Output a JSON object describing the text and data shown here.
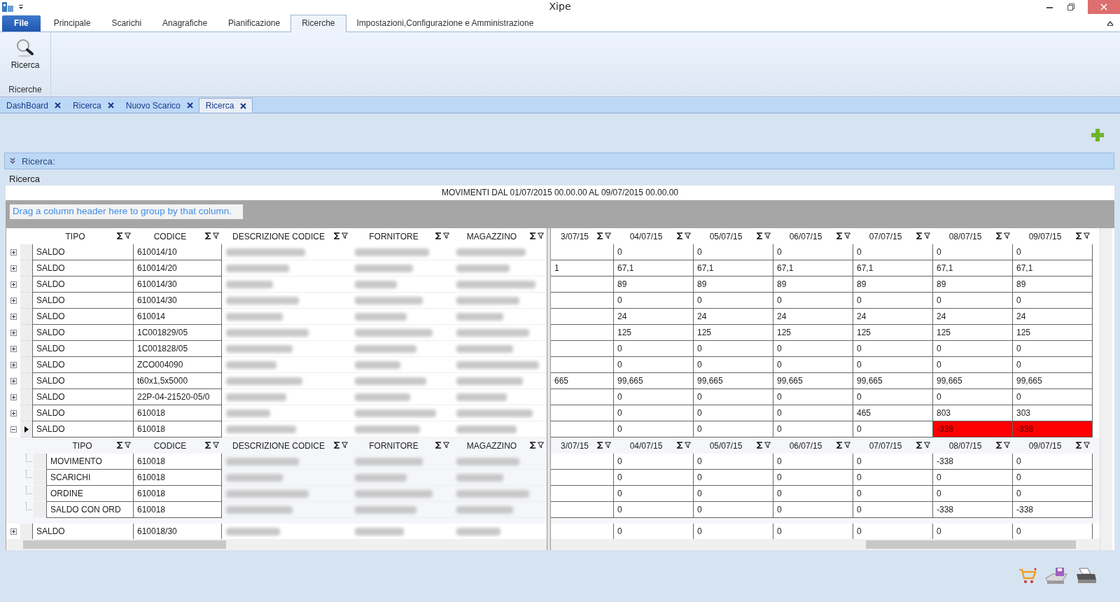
{
  "window": {
    "title": "Xipe"
  },
  "ribbon_tabs": [
    {
      "label": "File",
      "kind": "file",
      "selected": false
    },
    {
      "label": "Principale",
      "kind": "tab",
      "selected": false
    },
    {
      "label": "Scarichi",
      "kind": "tab",
      "selected": false
    },
    {
      "label": "Anagrafiche",
      "kind": "tab",
      "selected": false
    },
    {
      "label": "Pianificazione",
      "kind": "tab",
      "selected": false
    },
    {
      "label": "Ricerche",
      "kind": "tab",
      "selected": true
    },
    {
      "label": "Impostazioni,Configurazione e Amministrazione",
      "kind": "tab",
      "selected": false
    }
  ],
  "ribbon_group": {
    "button": "Ricerca",
    "label": "Ricerche"
  },
  "doc_tabs": [
    {
      "label": "DashBoard",
      "selected": false
    },
    {
      "label": "Ricerca",
      "selected": false
    },
    {
      "label": "Nuovo Scarico",
      "selected": false
    },
    {
      "label": "Ricerca",
      "selected": true
    }
  ],
  "panel": {
    "header": "Ricerca:",
    "subtitle": "Ricerca",
    "caption": "MOVIMENTI DAL 01/07/2015 00.00.00 AL 09/07/2015 00.00.00",
    "group_hint": "Drag a column header here to group by that column."
  },
  "left_columns": [
    "TIPO",
    "CODICE",
    "DESCRIZIONE CODICE",
    "FORNITORE",
    "MAGAZZINO"
  ],
  "right_columns": [
    "3/07/15",
    "04/07/15",
    "05/07/15",
    "06/07/15",
    "07/07/15",
    "08/07/15",
    "09/07/15"
  ],
  "rows": [
    {
      "tipo": "SALDO",
      "codice": "610014/10",
      "cells": [
        "",
        "0",
        "0",
        "0",
        "0",
        "0",
        "0"
      ],
      "flagged": [
        false,
        false,
        false,
        false,
        false,
        false,
        false
      ],
      "expanded": false,
      "current": false
    },
    {
      "tipo": "SALDO",
      "codice": "610014/20",
      "cells": [
        "1",
        "67,1",
        "67,1",
        "67,1",
        "67,1",
        "67,1",
        "67,1"
      ],
      "flagged": [
        false,
        false,
        false,
        false,
        false,
        false,
        false
      ],
      "expanded": false,
      "current": false
    },
    {
      "tipo": "SALDO",
      "codice": "610014/30",
      "cells": [
        "",
        "89",
        "89",
        "89",
        "89",
        "89",
        "89"
      ],
      "flagged": [
        false,
        false,
        false,
        false,
        false,
        false,
        false
      ],
      "expanded": false,
      "current": false
    },
    {
      "tipo": "SALDO",
      "codice": "610014/30",
      "cells": [
        "",
        "0",
        "0",
        "0",
        "0",
        "0",
        "0"
      ],
      "flagged": [
        false,
        false,
        false,
        false,
        false,
        false,
        false
      ],
      "expanded": false,
      "current": false
    },
    {
      "tipo": "SALDO",
      "codice": "610014",
      "cells": [
        "",
        "24",
        "24",
        "24",
        "24",
        "24",
        "24"
      ],
      "flagged": [
        false,
        false,
        false,
        false,
        false,
        false,
        false
      ],
      "expanded": false,
      "current": false
    },
    {
      "tipo": "SALDO",
      "codice": "1C001829/05",
      "cells": [
        "",
        "125",
        "125",
        "125",
        "125",
        "125",
        "125"
      ],
      "flagged": [
        false,
        false,
        false,
        false,
        false,
        false,
        false
      ],
      "expanded": false,
      "current": false
    },
    {
      "tipo": "SALDO",
      "codice": "1C001828/05",
      "cells": [
        "",
        "0",
        "0",
        "0",
        "0",
        "0",
        "0"
      ],
      "flagged": [
        false,
        false,
        false,
        false,
        false,
        false,
        false
      ],
      "expanded": false,
      "current": false
    },
    {
      "tipo": "SALDO",
      "codice": "ZCO004090",
      "cells": [
        "",
        "0",
        "0",
        "0",
        "0",
        "0",
        "0"
      ],
      "flagged": [
        false,
        false,
        false,
        false,
        false,
        false,
        false
      ],
      "expanded": false,
      "current": false
    },
    {
      "tipo": "SALDO",
      "codice": "t60x1,5x5000",
      "cells": [
        "665",
        "99,665",
        "99,665",
        "99,665",
        "99,665",
        "99,665",
        "99,665"
      ],
      "flagged": [
        false,
        false,
        false,
        false,
        false,
        false,
        false
      ],
      "expanded": false,
      "current": false
    },
    {
      "tipo": "SALDO",
      "codice": "22P-04-21520-05/0",
      "cells": [
        "",
        "0",
        "0",
        "0",
        "0",
        "0",
        "0"
      ],
      "flagged": [
        false,
        false,
        false,
        false,
        false,
        false,
        false
      ],
      "expanded": false,
      "current": false
    },
    {
      "tipo": "SALDO",
      "codice": "610018",
      "cells": [
        "",
        "0",
        "0",
        "0",
        "465",
        "803",
        "303"
      ],
      "flagged": [
        false,
        false,
        false,
        false,
        false,
        false,
        false
      ],
      "expanded": false,
      "current": false
    },
    {
      "tipo": "SALDO",
      "codice": "610018",
      "cells": [
        "",
        "0",
        "0",
        "0",
        "0",
        "-338",
        "-338"
      ],
      "flagged": [
        false,
        false,
        false,
        false,
        false,
        true,
        true
      ],
      "expanded": true,
      "current": true,
      "detail_left_columns": [
        "TIPO",
        "CODICE",
        "DESCRIZIONE CODICE",
        "FORNITORE",
        "MAGAZZINO"
      ],
      "detail_right_columns": [
        "3/07/15",
        "04/07/15",
        "05/07/15",
        "06/07/15",
        "07/07/15",
        "08/07/15",
        "09/07/15"
      ],
      "children": [
        {
          "tipo": "MOVIMENTO",
          "codice": "610018",
          "cells": [
            "",
            "0",
            "0",
            "0",
            "0",
            "-338",
            "0"
          ]
        },
        {
          "tipo": "SCARICHI",
          "codice": "610018",
          "cells": [
            "",
            "0",
            "0",
            "0",
            "0",
            "0",
            "0"
          ]
        },
        {
          "tipo": "ORDINE",
          "codice": "610018",
          "cells": [
            "",
            "0",
            "0",
            "0",
            "0",
            "0",
            "0"
          ]
        },
        {
          "tipo": "SALDO CON ORD",
          "codice": "610018",
          "cells": [
            "",
            "0",
            "0",
            "0",
            "0",
            "-338",
            "-338"
          ]
        }
      ]
    },
    {
      "tipo": "SALDO",
      "codice": "610018/30",
      "cells": [
        "",
        "0",
        "0",
        "0",
        "0",
        "0",
        "0"
      ],
      "flagged": [
        false,
        false,
        false,
        false,
        false,
        false,
        false
      ],
      "expanded": false,
      "current": false
    }
  ]
}
